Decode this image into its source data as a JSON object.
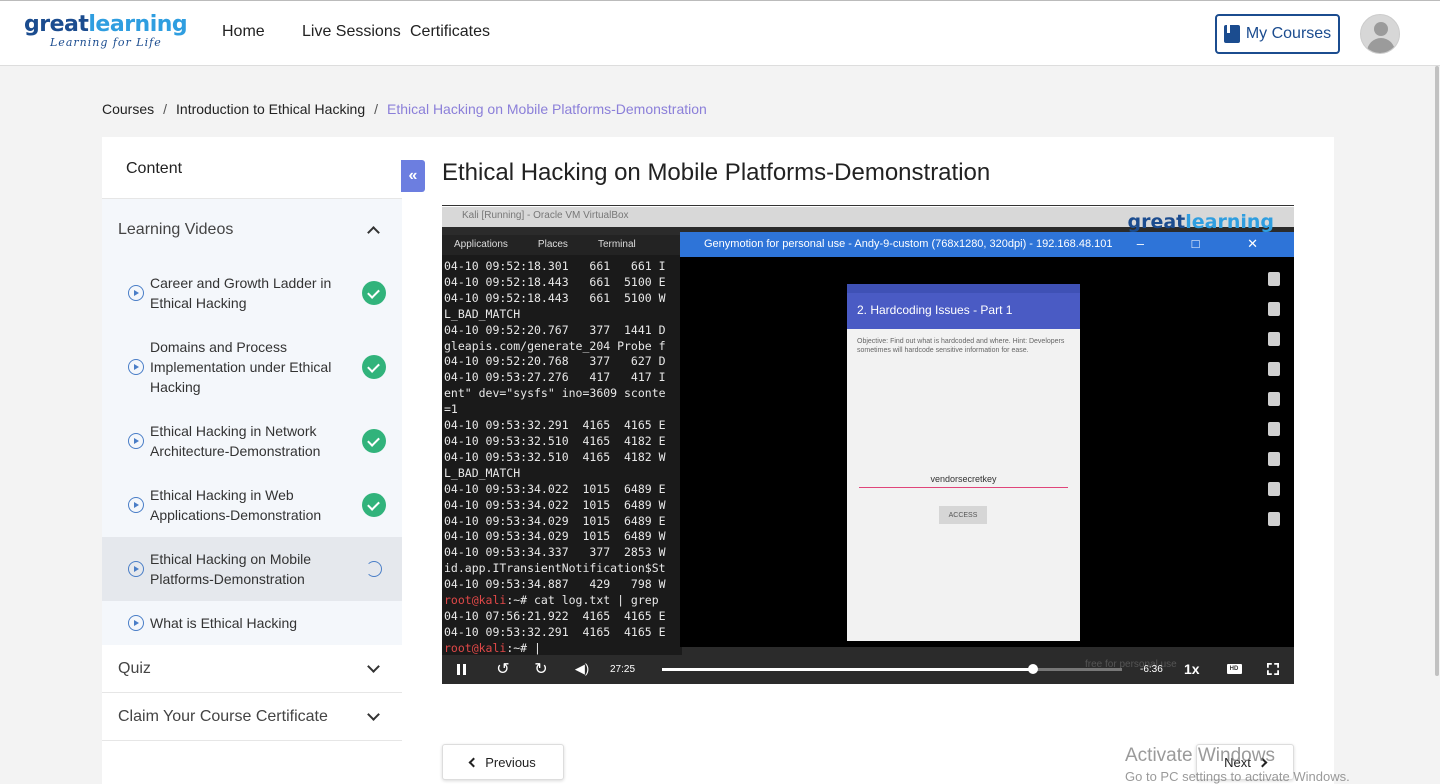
{
  "header": {
    "logo_main_1": "great",
    "logo_main_2": "learning",
    "logo_sub": "Learning for Life",
    "nav": [
      "Home",
      "Live Sessions",
      "Certificates"
    ],
    "my_courses": "My Courses"
  },
  "breadcrumb": {
    "items": [
      "Courses",
      "Introduction to Ethical Hacking",
      "Ethical Hacking on Mobile Platforms-Demonstration"
    ],
    "separator": "/"
  },
  "sidebar": {
    "title": "Content",
    "collapse_glyph": "«",
    "sections": [
      {
        "label": "Learning Videos",
        "expanded": true
      },
      {
        "label": "Quiz",
        "expanded": false
      },
      {
        "label": "Claim Your Course Certificate",
        "expanded": false
      }
    ],
    "videos": [
      {
        "title": "Career and Growth Ladder in Ethical Hacking",
        "status": "completed"
      },
      {
        "title": "Domains and Process Implementation under Ethical Hacking",
        "status": "completed"
      },
      {
        "title": "Ethical Hacking in Network Architecture-Demonstration",
        "status": "completed"
      },
      {
        "title": "Ethical Hacking in Web Applications-Demonstration",
        "status": "completed"
      },
      {
        "title": "Ethical Hacking on Mobile Platforms-Demonstration",
        "status": "in-progress"
      },
      {
        "title": "What is Ethical Hacking",
        "status": "none"
      }
    ]
  },
  "main": {
    "title": "Ethical Hacking on Mobile Platforms-Demonstration"
  },
  "video": {
    "vbox_title": "Kali [Running] - Oracle VM VirtualBox",
    "watermark_1": "great",
    "watermark_2": "learning",
    "kali_menu": [
      "Applications",
      "Places",
      "Terminal"
    ],
    "geny_title": "Genymotion for personal use - Andy-9-custom (768x1280, 320dpi) - 192.168.48.101",
    "geny_controls": "– □ ✕",
    "phone_appbar": "2. Hardcoding Issues - Part 1",
    "phone_objective": "Objective: Find out what is hardcoded and where. Hint: Developers sometimes will hardcode sensitive information for ease.",
    "phone_input_value": "vendorsecretkey",
    "phone_button": "ACCESS",
    "free_use": "free for personal use",
    "terminal_lines": [
      "04-10 09:52:18.301   661   661 I",
      "04-10 09:52:18.443   661  5100 E",
      "04-10 09:52:18.443   661  5100 W",
      "L_BAD_MATCH",
      "04-10 09:52:20.767   377  1441 D",
      "gleapis.com/generate_204 Probe f",
      "04-10 09:52:20.768   377   627 D",
      "04-10 09:53:27.276   417   417 I",
      "ent\" dev=\"sysfs\" ino=3609 sconte",
      "=1",
      "04-10 09:53:32.291  4165  4165 E",
      "04-10 09:53:32.510  4165  4182 E",
      "04-10 09:53:32.510  4165  4182 W",
      "L_BAD_MATCH",
      "04-10 09:53:34.022  1015  6489 E",
      "04-10 09:53:34.022  1015  6489 W",
      "04-10 09:53:34.029  1015  6489 E",
      "04-10 09:53:34.029  1015  6489 W",
      "04-10 09:53:34.337   377  2853 W",
      "id.app.ITransientNotification$St",
      "04-10 09:53:34.887   429   798 W",
      "root@kali:~# cat log.txt | grep",
      "04-10 07:56:21.922  4165  4165 E",
      "04-10 09:53:32.291  4165  4165 E",
      "root@kali:~# |"
    ],
    "time_current": "27:25",
    "time_remaining": "-6:36",
    "speed": "1x",
    "hd": "HD",
    "progress_fraction": 0.807
  },
  "nav_buttons": {
    "previous": "Previous",
    "next": "Next"
  },
  "windows_watermark": {
    "line1": "Activate Windows",
    "line2": "Go to PC settings to activate Windows."
  }
}
